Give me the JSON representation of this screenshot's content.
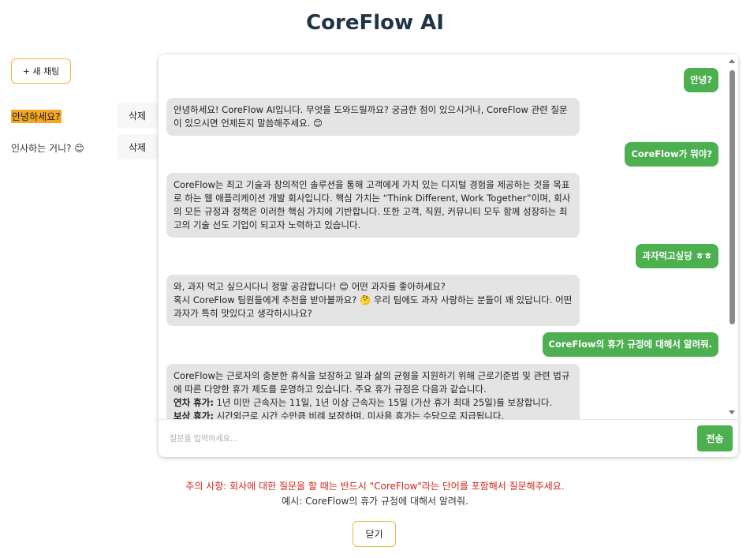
{
  "app": {
    "title": "CoreFlow AI"
  },
  "sidebar": {
    "new_chat_label": "+ 새 채팅",
    "sessions": [
      {
        "label": "안녕하세요?",
        "active": true,
        "delete_label": "삭제"
      },
      {
        "label": "인사하는 거니? 😊",
        "active": false,
        "delete_label": "삭제"
      }
    ]
  },
  "chat": {
    "messages": [
      {
        "role": "user",
        "text": "안녕?"
      },
      {
        "role": "bot",
        "lines": [
          "안녕하세요! CoreFlow AI입니다. 무엇을 도와드릴까요? 궁금한 점이 있으시거나, CoreFlow 관련 질문이 있으시면 언제든지 말씀해주세요. 😊"
        ]
      },
      {
        "role": "user",
        "text": "CoreFlow가 뭐야?"
      },
      {
        "role": "bot",
        "lines": [
          "CoreFlow는 최고 기술과 창의적인 솔루션을 통해 고객에게 가치 있는 디지털 경험을 제공하는 것을 목표로 하는 웹 애플리케이션 개발 회사입니다. 핵심 가치는 “Think Different, Work Together”이며, 회사의 모든 규정과 정책은 이러한 핵심 가치에 기반합니다. 또한 고객, 직원, 커뮤니티 모두 함께 성장하는 최고의 기술 선도 기업이 되고자 노력하고 있습니다."
        ]
      },
      {
        "role": "user",
        "text": "과자먹고싶당 ㅎㅎ"
      },
      {
        "role": "bot",
        "lines": [
          "와, 과자 먹고 싶으시다니 정말 공감합니다! 😊 어떤 과자를 좋아하세요?",
          "혹시 CoreFlow 팀원들에게 추천을 받아볼까요? 🤔 우리 팀에도 과자 사랑하는 분들이 꽤 있답니다. 어떤 과자가 특히 맛있다고 생각하시나요?"
        ]
      },
      {
        "role": "user",
        "text": "CoreFlow의 휴가 규정에 대해서 알려줘."
      },
      {
        "role": "bot",
        "lines": [
          "CoreFlow는 근로자의 충분한 휴식을 보장하고 일과 삶의 균형을 지원하기 위해 근로기준법 및 관련 법규에 따른 다양한 휴가 제도를 운영하고 있습니다. 주요 휴가 규정은 다음과 같습니다."
        ],
        "items": [
          {
            "term": "연차 휴가:",
            "desc": " 1년 미만 근속자는 11일, 1년 이상 근속자는 15일 (가산 휴가 최대 25일)를 보장합니다."
          },
          {
            "term": "보상 휴가:",
            "desc": " 시간외근로 시간 수만큼 비례 보장하며, 미사용 휴가는 수당으로 지급됩니다."
          }
        ]
      }
    ],
    "input_placeholder": "질문을 입력하세요...",
    "send_label": "전송"
  },
  "notices": {
    "warning": "주의 사항: 회사에 대한 질문을 할 때는 반드시 \"CoreFlow\"라는 단어를 포함해서 질문해주세요.",
    "example": "예시: CoreFlow의 휴가 규정에 대해서 알려줘."
  },
  "close_label": "닫기",
  "colors": {
    "accent": "#4caf50",
    "highlight": "#f5a623",
    "border_accent": "#f2b33d",
    "warning": "#d0241c"
  }
}
